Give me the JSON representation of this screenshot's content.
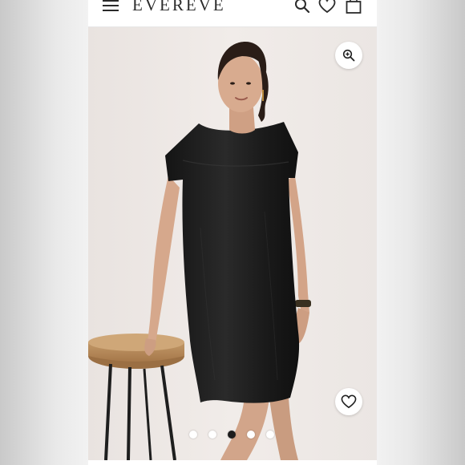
{
  "header": {
    "logo_text": "EVEREVE",
    "menu_icon": "hamburger-menu-icon",
    "search_icon": "search-icon",
    "wishlist_icon": "heart-icon",
    "bag_icon": "shopping-bag-icon"
  },
  "product_gallery": {
    "zoom_icon": "zoom-in-icon",
    "favorite_icon": "heart-outline-icon",
    "image_count": 5,
    "active_index": 3,
    "colors": {
      "dress": "#1b1b1b",
      "background": "#eee9e6",
      "stool_wood": "#b88c5b",
      "active_dot": "#1c1c1c"
    }
  }
}
